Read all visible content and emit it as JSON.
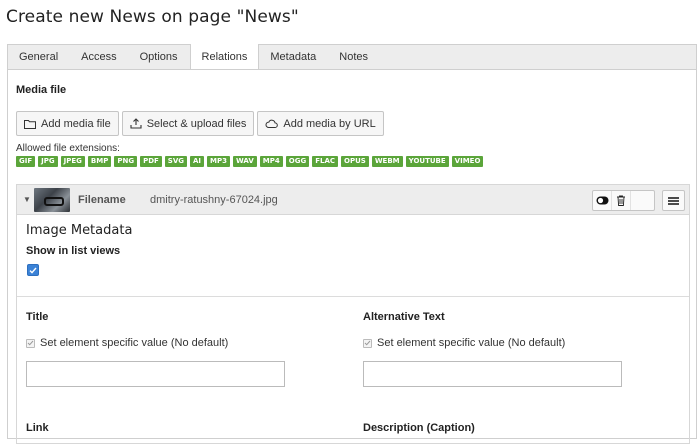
{
  "page": {
    "title": "Create new News on page \"News\""
  },
  "tabs": [
    {
      "label": "General"
    },
    {
      "label": "Access"
    },
    {
      "label": "Options"
    },
    {
      "label": "Relations",
      "active": true
    },
    {
      "label": "Metadata"
    },
    {
      "label": "Notes"
    }
  ],
  "media": {
    "section_label": "Media file",
    "buttons": {
      "add_media_file": "Add media file",
      "select_upload": "Select & upload files",
      "add_by_url": "Add media by URL"
    },
    "allowed_label": "Allowed file extensions:",
    "extensions": [
      "GIF",
      "JPG",
      "JPEG",
      "BMP",
      "PNG",
      "PDF",
      "SVG",
      "AI",
      "MP3",
      "WAV",
      "MP4",
      "OGG",
      "FLAC",
      "OPUS",
      "WEBM",
      "YOUTUBE",
      "VIMEO"
    ],
    "extension_color": "#5ba53a"
  },
  "file": {
    "filename_label": "Filename",
    "filename_value": "dmitry-ratushny-67024.jpg",
    "icons": [
      "toggle-icon",
      "trash-icon",
      "menu-icon"
    ],
    "metadata_title": "Image Metadata",
    "show_in_list_label": "Show in list views",
    "show_in_list_checked": true
  },
  "fields": {
    "title": {
      "label": "Title",
      "checkbox_label": "Set element specific value (No default)",
      "value": ""
    },
    "alt_text": {
      "label": "Alternative Text",
      "checkbox_label": "Set element specific value (No default)",
      "value": ""
    },
    "link": {
      "label": "Link"
    },
    "description": {
      "label": "Description (Caption)"
    }
  },
  "colors": {
    "checkbox_accent": "#3b82d6",
    "header_bg": "#ededed"
  }
}
